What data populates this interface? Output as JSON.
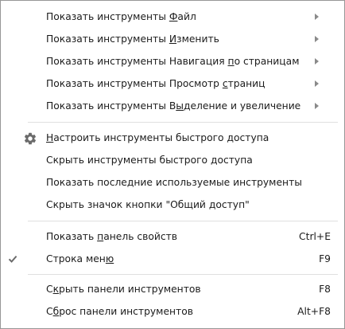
{
  "menu": {
    "items": [
      {
        "prefix": "Показать инструменты ",
        "accel": "Ф",
        "suffix": "айл"
      },
      {
        "prefix": "Показать инструменты ",
        "accel": "И",
        "suffix": "зменить"
      },
      {
        "prefix": "Показать инструменты Навигация ",
        "accel": "п",
        "suffix": "о страницам"
      },
      {
        "prefix": "Показать инструменты Просмотр ",
        "accel": "с",
        "suffix": "траниц"
      },
      {
        "prefix": "Показать инструменты В",
        "accel": "ы",
        "suffix": "деление и увеличение"
      },
      {
        "prefix": "",
        "accel": "Н",
        "suffix": "астроить инструменты быстрого доступа"
      },
      {
        "prefix": "Скрыть инструменты быстрого доступа",
        "accel": "",
        "suffix": ""
      },
      {
        "prefix": "Показать последние используемые инструменты",
        "accel": "",
        "suffix": ""
      },
      {
        "prefix": "Скрыть значок кнопки \"Общий доступ\"",
        "accel": "",
        "suffix": ""
      },
      {
        "prefix": "Показать ",
        "accel": "п",
        "suffix": "анель свойств",
        "shortcut": "Ctrl+E"
      },
      {
        "prefix": "Строка мен",
        "accel": "ю",
        "suffix": "",
        "shortcut": "F9"
      },
      {
        "prefix": "С",
        "accel": "к",
        "suffix": "рыть панели инструментов",
        "shortcut": "F8"
      },
      {
        "prefix": "С",
        "accel": "б",
        "suffix": "рос панели инструментов",
        "shortcut": "Alt+F8"
      }
    ]
  },
  "icons": {
    "submenu": "chevron-right-icon",
    "settings": "gear-icon",
    "checked": "checkmark-icon"
  },
  "colors": {
    "text": "#1b1b1b",
    "border": "#979797",
    "separator": "#e0e0e0",
    "icon": "#6b6b6b"
  }
}
